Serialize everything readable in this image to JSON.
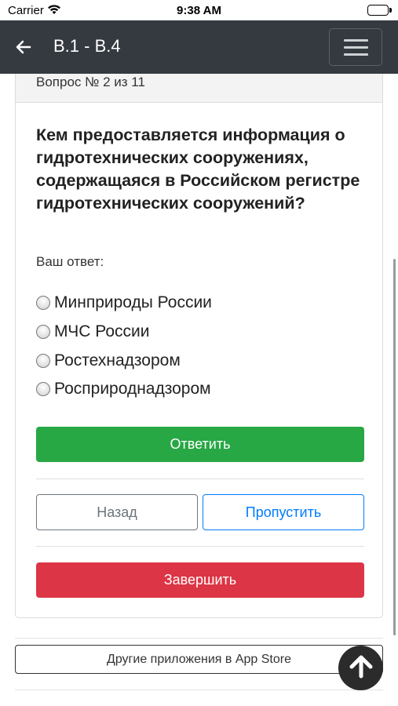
{
  "status_bar": {
    "carrier": "Carrier",
    "time": "9:38 AM"
  },
  "nav": {
    "title": "В.1 - В.4",
    "back_icon": "arrow-left-icon",
    "menu_icon": "hamburger-menu-icon"
  },
  "quiz": {
    "question_number": "Вопрос № 2 из 11",
    "question": "Кем предоставляется информация о гидротехнических сооружениях, содержащаяся в Российском регистре гидротехнических сооружений?",
    "answer_label": "Ваш ответ:",
    "options": [
      {
        "label": "Минприроды России",
        "selected": false
      },
      {
        "label": "МЧС России",
        "selected": false
      },
      {
        "label": "Ростехнадзором",
        "selected": false
      },
      {
        "label": "Росприроднадзором",
        "selected": false
      }
    ]
  },
  "buttons": {
    "answer": "Ответить",
    "back": "Назад",
    "skip": "Пропустить",
    "finish": "Завершить"
  },
  "footer": {
    "app_store": "Другие приложения в App Store",
    "scroll_top_icon": "arrow-up-icon"
  },
  "colors": {
    "navbar": "#343a40",
    "success": "#28a745",
    "danger": "#dc3545",
    "primary": "#007bff",
    "secondary": "#6c757d"
  }
}
